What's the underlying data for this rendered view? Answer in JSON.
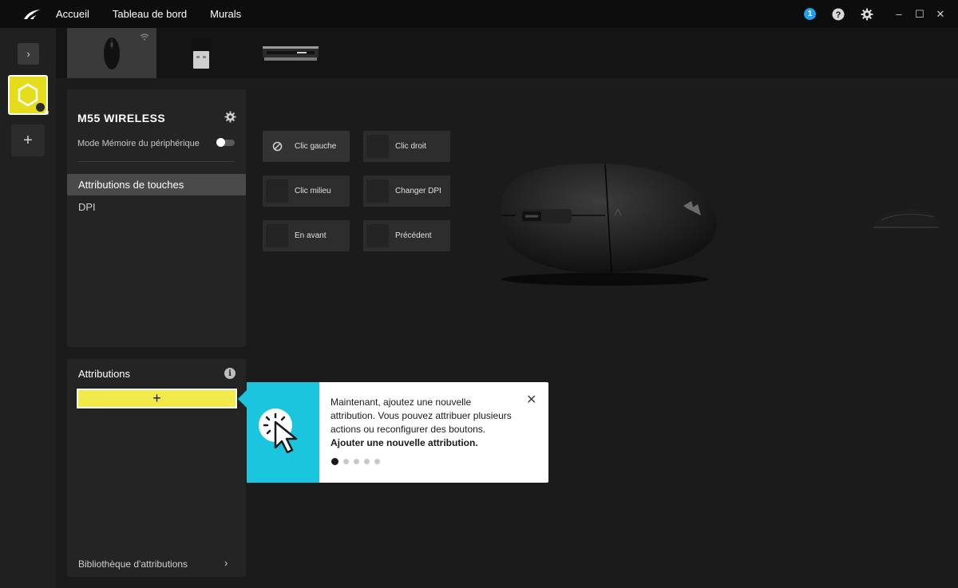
{
  "topbar": {
    "nav": [
      "Accueil",
      "Tableau de bord",
      "Murals"
    ],
    "notifications_count": "1",
    "icons": [
      "corsair-sails-logo",
      "help-icon",
      "settings-gear-icon"
    ],
    "window_controls": [
      "–",
      "☐",
      "✕"
    ]
  },
  "leftrail": {
    "expand_label": "›",
    "add_label": "+"
  },
  "devices": [
    {
      "name": "M55 WIRELESS",
      "icon": "mouse-icon",
      "active": true
    },
    {
      "name": "",
      "icon": "usb-receiver-icon",
      "active": false
    },
    {
      "name": "",
      "icon": "memory-stick-icon",
      "active": false
    }
  ],
  "device_panel": {
    "name": "M55 WIRELESS",
    "memory_mode_label": "Mode Mémoire du périphérique",
    "memory_mode_on": false,
    "menu": [
      "Attributions de touches",
      "DPI"
    ],
    "active_menu": "Attributions de touches"
  },
  "attributions_panel": {
    "title": "Attributions",
    "add_label": "+",
    "library_label": "Bibliothèque d'attributions",
    "library_chevron": "›"
  },
  "keys": [
    {
      "label": "Clic gauche",
      "disabled_icon": true
    },
    {
      "label": "Clic droit"
    },
    {
      "label": "Clic milieu"
    },
    {
      "label": "Changer DPI"
    },
    {
      "label": "En avant"
    },
    {
      "label": "Précédent"
    }
  ],
  "tooltip": {
    "text": "Maintenant, ajoutez une nouvelle attribution. Vous pouvez attribuer plusieurs actions ou reconfigurer des boutons.",
    "bold": "Ajouter une nouvelle attribution.",
    "close": "✕",
    "step": 1,
    "steps": 5
  },
  "colors": {
    "accent_yellow": "#e5dd1c",
    "tooltip_cyan": "#1cc5de",
    "notification_blue": "#1fa0f0"
  }
}
